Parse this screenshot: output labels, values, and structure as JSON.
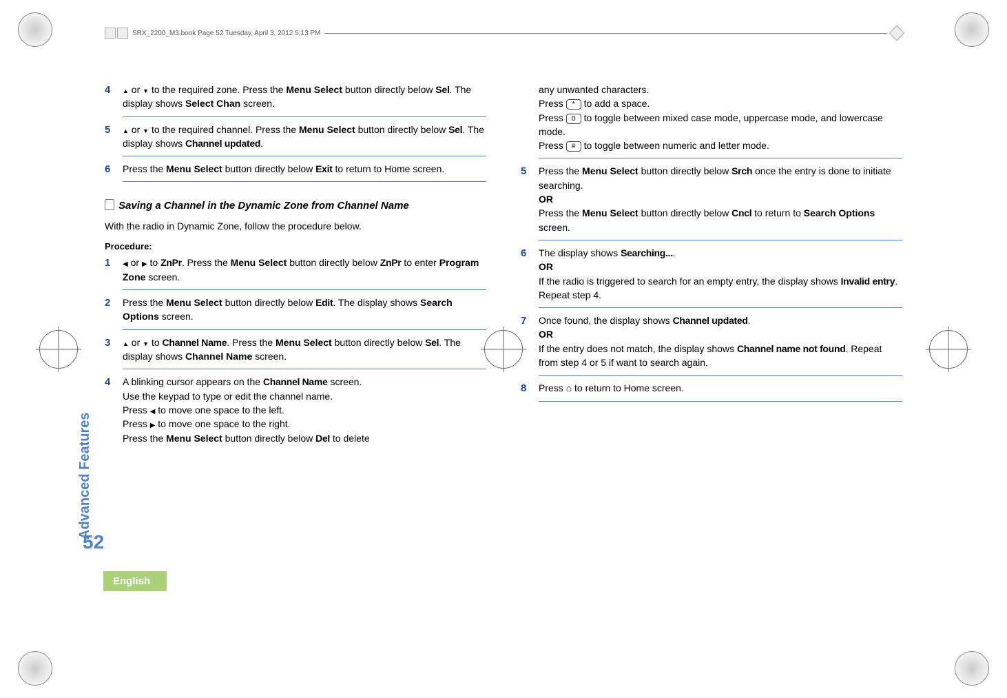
{
  "book_header": "SRX_2200_M3.book  Page 52  Tuesday, April 3, 2012  5:13 PM",
  "side_tab": "Advanced Features",
  "page_number": "52",
  "language": "English",
  "left_col": {
    "step4": {
      "num": "4",
      "text_a": " or ",
      "text_b": " to the required zone. Press the ",
      "menu_select": "Menu Select",
      "text_c": " button directly below ",
      "sel": "Sel",
      "text_d": ". The display shows ",
      "select_chan": "Select Chan",
      "text_e": " screen."
    },
    "step5": {
      "num": "5",
      "text_a": " or ",
      "text_b": " to the required channel. Press the ",
      "menu_select": "Menu Select",
      "text_c": " button directly below ",
      "sel": "Sel",
      "text_d": ". The display shows ",
      "channel_updated": "Channel updated",
      "period": "."
    },
    "step6": {
      "num": "6",
      "text_a": "Press the ",
      "menu_select": "Menu Select",
      "text_b": " button directly below ",
      "exit": "Exit",
      "text_c": " to return to Home screen."
    },
    "subheading": "Saving a Channel in the Dynamic Zone from Channel Name",
    "intro": "With the radio in Dynamic Zone, follow the procedure below.",
    "procedure_label": "Procedure:",
    "p1": {
      "num": "1",
      "a": " or ",
      "b": " to ",
      "znpr": "ZnPr",
      "c": ". Press the ",
      "menu_select": "Menu Select",
      "d": " button directly below ",
      "znpr2": "ZnPr",
      "e": " to enter ",
      "program_zone": "Program Zone",
      "f": " screen."
    },
    "p2": {
      "num": "2",
      "a": "Press the ",
      "menu_select": "Menu Select",
      "b": " button directly below ",
      "edit": "Edit",
      "c": ". The display shows ",
      "search_options": "Search Options",
      "d": " screen."
    },
    "p3": {
      "num": "3",
      "a": " or ",
      "b": " to ",
      "channel_name": "Channel Name",
      "c": ". Press the ",
      "menu_select": "Menu Select",
      "d": " button directly below ",
      "sel": "Sel",
      "e": ". The display shows ",
      "channel_name_b": "Channel Name",
      "f": " screen."
    },
    "p4": {
      "num": "4",
      "a": "A blinking cursor appears on the ",
      "channel_name": "Channel Name",
      "b": " screen.",
      "c": "Use the keypad to type or edit the channel name.",
      "d": "Press ",
      "e": " to move one space to the left.",
      "f": "Press ",
      "g": " to move one space to the right.",
      "h": "Press the ",
      "menu_select": "Menu Select",
      "i": " button directly below ",
      "del": "Del",
      "j": " to delete"
    }
  },
  "right_col": {
    "cont": {
      "a": "any unwanted characters.",
      "b": "Press ",
      "key_star": "*",
      "c": " to add a space.",
      "d": "Press ",
      "key_0": "0",
      "e": " to toggle between mixed case mode, uppercase mode, and lowercase mode.",
      "f": "Press ",
      "key_hash": "#",
      "g": " to toggle between numeric and letter mode."
    },
    "step5": {
      "num": "5",
      "a": "Press the ",
      "menu_select": "Menu Select",
      "b": " button directly below ",
      "srch": "Srch",
      "c": " once the entry is done to initiate searching.",
      "or": "OR",
      "d": "Press the ",
      "menu_select2": "Menu Select",
      "e": " button directly below ",
      "cncl": "Cncl",
      "f": " to return to ",
      "search_options": "Search Options",
      "g": " screen."
    },
    "step6": {
      "num": "6",
      "a": "The display shows ",
      "searching": "Searching...",
      "b": ".",
      "or": "OR",
      "c": "If the radio is triggered to search for an empty entry, the display shows ",
      "invalid": "Invalid entry",
      "d": ". Repeat step 4."
    },
    "step7": {
      "num": "7",
      "a": "Once found, the display shows ",
      "channel_updated": "Channel updated",
      "b": ".",
      "or": "OR",
      "c": "If the entry does not match, the display shows ",
      "not_found": "Channel name not found",
      "d": ". Repeat from step 4 or 5 if want to search again."
    },
    "step8": {
      "num": "8",
      "a": "Press ",
      "b": " to return to Home screen."
    }
  }
}
